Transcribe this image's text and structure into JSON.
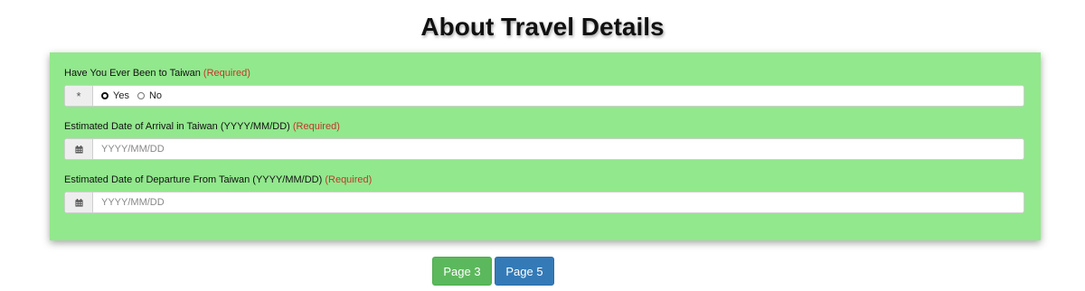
{
  "header": {
    "title": "About Travel Details"
  },
  "form": {
    "visited_taiwan": {
      "label": "Have You Ever Been to Taiwan",
      "required_text": "(Required)",
      "addon_symbol": "*",
      "options": [
        {
          "label": "Yes",
          "selected": true
        },
        {
          "label": "No",
          "selected": false
        }
      ]
    },
    "arrival_date": {
      "label": "Estimated Date of Arrival in Taiwan (YYYY/MM/DD)",
      "required_text": "(Required)",
      "placeholder": "YYYY/MM/DD",
      "value": "",
      "icon": "calendar-icon"
    },
    "departure_date": {
      "label": "Estimated Date of Departure From Taiwan (YYYY/MM/DD)",
      "required_text": "(Required)",
      "placeholder": "YYYY/MM/DD",
      "value": "",
      "icon": "calendar-icon"
    }
  },
  "navigation": {
    "prev_label": "Page 3",
    "next_label": "Page 5"
  },
  "colors": {
    "panel_background": "#92e88d",
    "required_text": "#c0392b",
    "prev_button": "#5cb85c",
    "next_button": "#337ab7"
  }
}
